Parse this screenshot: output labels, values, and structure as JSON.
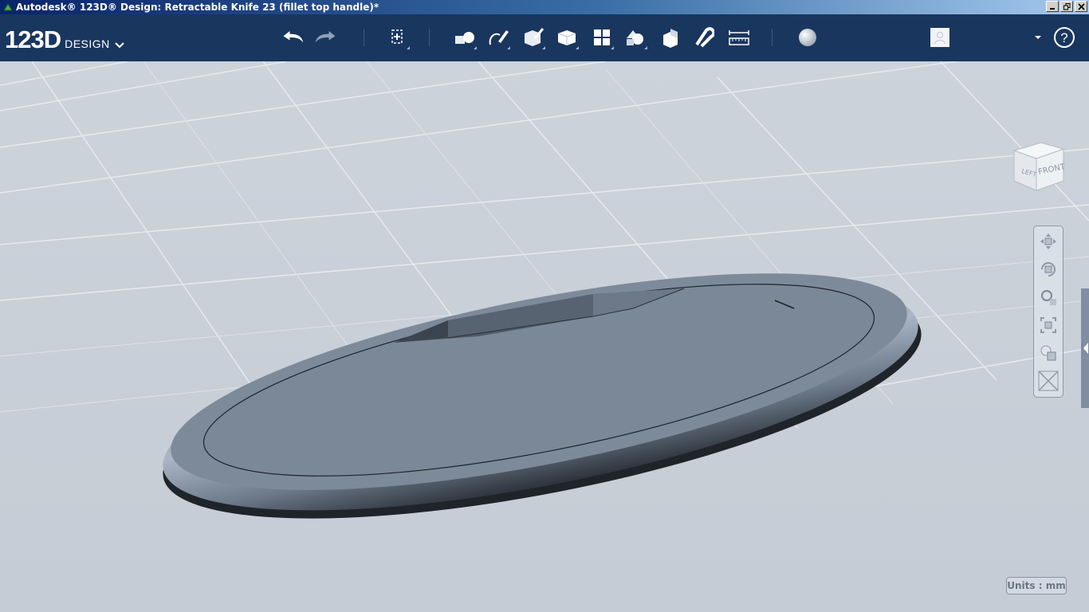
{
  "window": {
    "title": "Autodesk® 123D® Design: Retractable Knife 23 (fillet top handle)*"
  },
  "app": {
    "logo_number": "123D",
    "logo_word": "DESIGN"
  },
  "toolbar": {
    "icons": [
      "undo-icon",
      "redo-icon",
      "transform-icon",
      "primitives-icon",
      "sketch-icon",
      "construct-icon",
      "modify-icon",
      "pattern-icon",
      "group-icon",
      "combine-icon",
      "snap-icon",
      "measure-icon",
      "material-icon",
      "account-icon",
      "dropdown-icon",
      "help-icon"
    ],
    "help_label": "?"
  },
  "viewcube": {
    "left": "LEFT",
    "front": "FRONT"
  },
  "units": {
    "label": "Units : mm"
  },
  "colors": {
    "toolbar_bg": "#19365f",
    "viewport_bg": "#c8cfd8",
    "model_fill": "#7a8898"
  }
}
